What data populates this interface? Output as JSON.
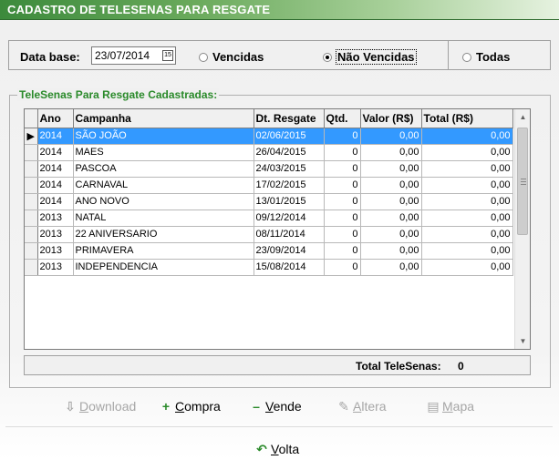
{
  "window": {
    "title": "CADASTRO DE TELESENAS PARA RESGATE"
  },
  "filter": {
    "date_label": "Data base:",
    "date_value": "23/07/2014",
    "calendar_icon": "calendar-icon",
    "options": [
      {
        "label": "Vencidas",
        "selected": false
      },
      {
        "label": "Não Vencidas",
        "selected": true
      },
      {
        "label": "Todas",
        "selected": false
      }
    ]
  },
  "group": {
    "title": "TeleSenas Para Resgate Cadastradas:"
  },
  "table": {
    "columns": [
      "Ano",
      "Campanha",
      "Dt. Resgate",
      "Qtd.",
      "Valor (R$)",
      "Total (R$)"
    ],
    "rows": [
      [
        "2014",
        "SÃO JOÃO",
        "02/06/2015",
        "0",
        "0,00",
        "0,00"
      ],
      [
        "2014",
        "MAES",
        "26/04/2015",
        "0",
        "0,00",
        "0,00"
      ],
      [
        "2014",
        "PASCOA",
        "24/03/2015",
        "0",
        "0,00",
        "0,00"
      ],
      [
        "2014",
        "CARNAVAL",
        "17/02/2015",
        "0",
        "0,00",
        "0,00"
      ],
      [
        "2014",
        "ANO NOVO",
        "13/01/2015",
        "0",
        "0,00",
        "0,00"
      ],
      [
        "2013",
        "NATAL",
        "09/12/2014",
        "0",
        "0,00",
        "0,00"
      ],
      [
        "2013",
        "22 ANIVERSARIO",
        "08/11/2014",
        "0",
        "0,00",
        "0,00"
      ],
      [
        "2013",
        "PRIMAVERA",
        "23/09/2014",
        "0",
        "0,00",
        "0,00"
      ],
      [
        "2013",
        "INDEPENDENCIA",
        "15/08/2014",
        "0",
        "0,00",
        "0,00"
      ]
    ],
    "selected_row": 0
  },
  "totals": {
    "label": "Total TeleSenas:",
    "value": "0"
  },
  "actions": {
    "download": {
      "hot": "D",
      "rest": "ownload",
      "icon": "download-icon",
      "enabled": false
    },
    "compra": {
      "hot": "C",
      "rest": "ompra",
      "icon": "plus-icon",
      "enabled": true
    },
    "vende": {
      "hot": "V",
      "rest": "ende",
      "icon": "minus-icon",
      "enabled": true
    },
    "altera": {
      "hot": "A",
      "rest": "ltera",
      "icon": "edit-icon",
      "enabled": false
    },
    "mapa": {
      "hot": "M",
      "rest": "apa",
      "icon": "map-icon",
      "enabled": false
    },
    "volta": {
      "hot": "V",
      "rest": "olta",
      "icon": "back-arrow-icon",
      "enabled": true
    }
  }
}
